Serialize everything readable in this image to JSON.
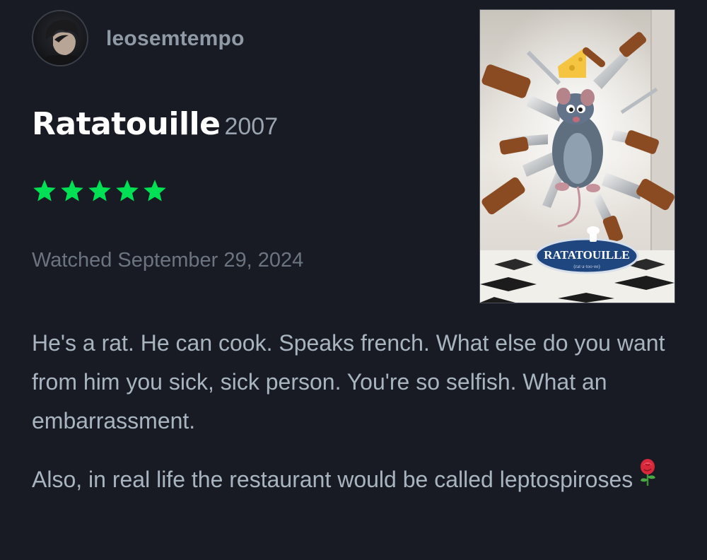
{
  "user": {
    "username": "leosemtempo"
  },
  "film": {
    "title": "Ratatouille",
    "year": "2007"
  },
  "rating": {
    "stars": 5,
    "max": 5,
    "color": "#00e054"
  },
  "watched": {
    "label": "Watched September 29, 2024"
  },
  "poster": {
    "logo_text": "RATATOUILLE",
    "logo_subtext": "(rat·a·too·ee)"
  },
  "review": {
    "paragraph_1": "He's a rat. He can cook. Speaks french. What else do you want from him you sick, sick person. You're so selfish. What an embarrassment.",
    "paragraph_2": "Also, in real life the restaurant would be called leptospiroses",
    "emoji_icon": "rose-icon"
  },
  "colors": {
    "background": "#181b23",
    "title": "#ffffff",
    "muted": "#6b7480",
    "body_text": "#a8b5c0",
    "star_green": "#00e054"
  }
}
